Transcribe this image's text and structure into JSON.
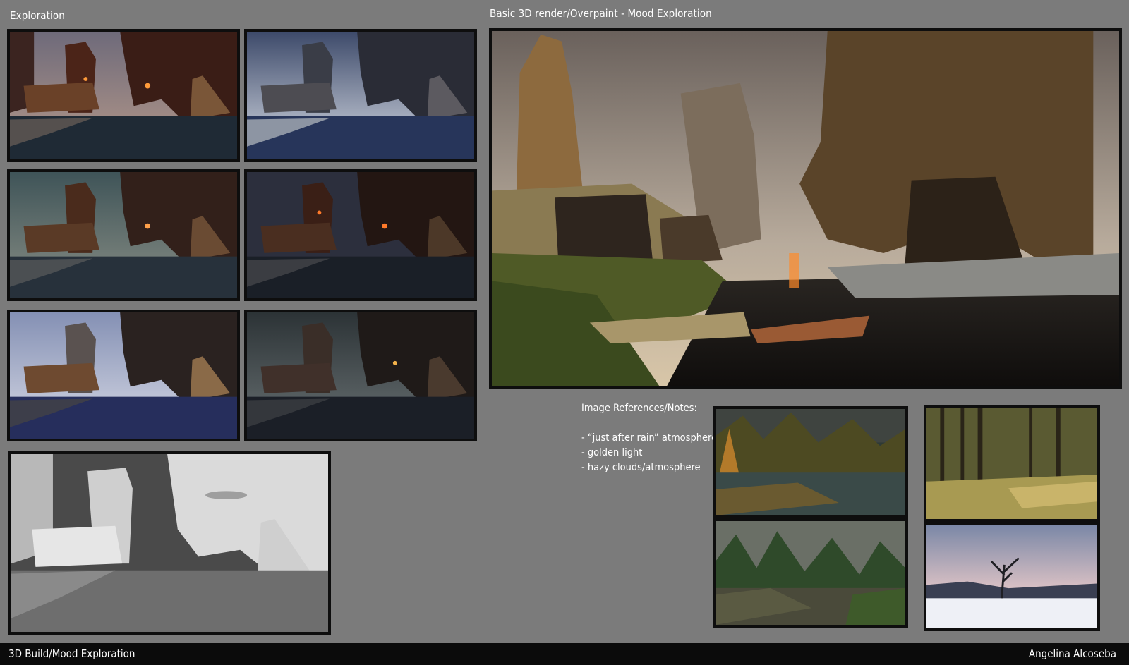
{
  "headings": {
    "exploration": "Exploration",
    "main_render": "Basic 3D render/Overpaint - Mood Exploration"
  },
  "notes": {
    "title": "Image References/Notes:",
    "items": [
      "- “just after rain” atmosphere",
      "- golden light",
      "- hazy clouds/atmosphere"
    ]
  },
  "footer": {
    "left": "3D Build/Mood Exploration",
    "right": "Angelina Alcoseba"
  },
  "colors": {
    "background": "#7b7b7b",
    "frame": "#0e0e0e",
    "footer_bar": "#0b0b0b",
    "text": "#ffffff"
  }
}
